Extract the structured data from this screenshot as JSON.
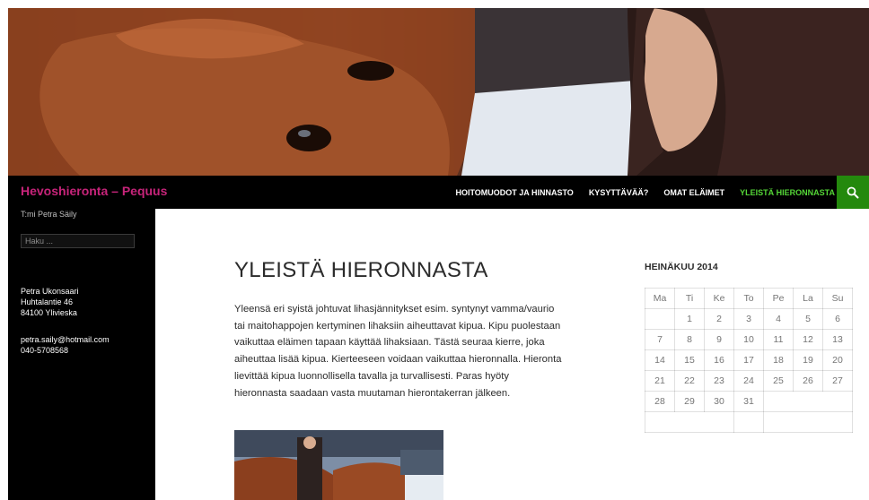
{
  "site": {
    "title": "Hevoshieronta – Pequus",
    "tagline": "T:mi Petra Säily"
  },
  "nav": {
    "items": [
      {
        "label": "HOITOMUODOT JA HINNASTO"
      },
      {
        "label": "KYSYTTÄVÄÄ?"
      },
      {
        "label": "OMAT ELÄIMET"
      },
      {
        "label": "YLEISTÄ HIERONNASTA"
      }
    ],
    "active_color": "#55d737",
    "search_icon": "search-icon"
  },
  "sidebar": {
    "search_placeholder": "Haku ...",
    "contact": {
      "name": "Petra Ukonsaari",
      "street": "Huhtalantie 46",
      "city": "84100 Ylivieska",
      "email": "petra.saily@hotmail.com",
      "phone": "040-5708568"
    }
  },
  "entry": {
    "title": "YLEISTÄ HIERONNASTA",
    "body": "Yleensä eri syistä johtuvat lihasjännitykset esim. syntynyt vamma/vaurio tai maitohappojen kertyminen lihaksiin aiheuttavat kipua. Kipu puolestaan vaikuttaa eläimen tapaan käyttää lihaksiaan. Tästä seuraa kierre, joka aiheuttaa lisää kipua. Kierteeseen voidaan vaikuttaa hieronnalla. Hieronta lievittää kipua luonnollisella tavalla ja turvallisesti. Paras hyöty hieronnasta saadaan vasta muutaman hierontakerran jälkeen."
  },
  "calendar": {
    "caption": "HEINÄKUU 2014",
    "weekdays": [
      "Ma",
      "Ti",
      "Ke",
      "To",
      "Pe",
      "La",
      "Su"
    ],
    "weeks": [
      [
        "",
        "1",
        "2",
        "3",
        "4",
        "5",
        "6"
      ],
      [
        "7",
        "8",
        "9",
        "10",
        "11",
        "12",
        "13"
      ],
      [
        "14",
        "15",
        "16",
        "17",
        "18",
        "19",
        "20"
      ],
      [
        "21",
        "22",
        "23",
        "24",
        "25",
        "26",
        "27"
      ],
      [
        "28",
        "29",
        "30",
        "31",
        "",
        "",
        ""
      ],
      [
        "",
        "",
        "",
        "",
        "",
        "",
        ""
      ]
    ]
  },
  "colors": {
    "brand": "#c7247a",
    "accent": "#24890d",
    "dark": "#000000"
  }
}
